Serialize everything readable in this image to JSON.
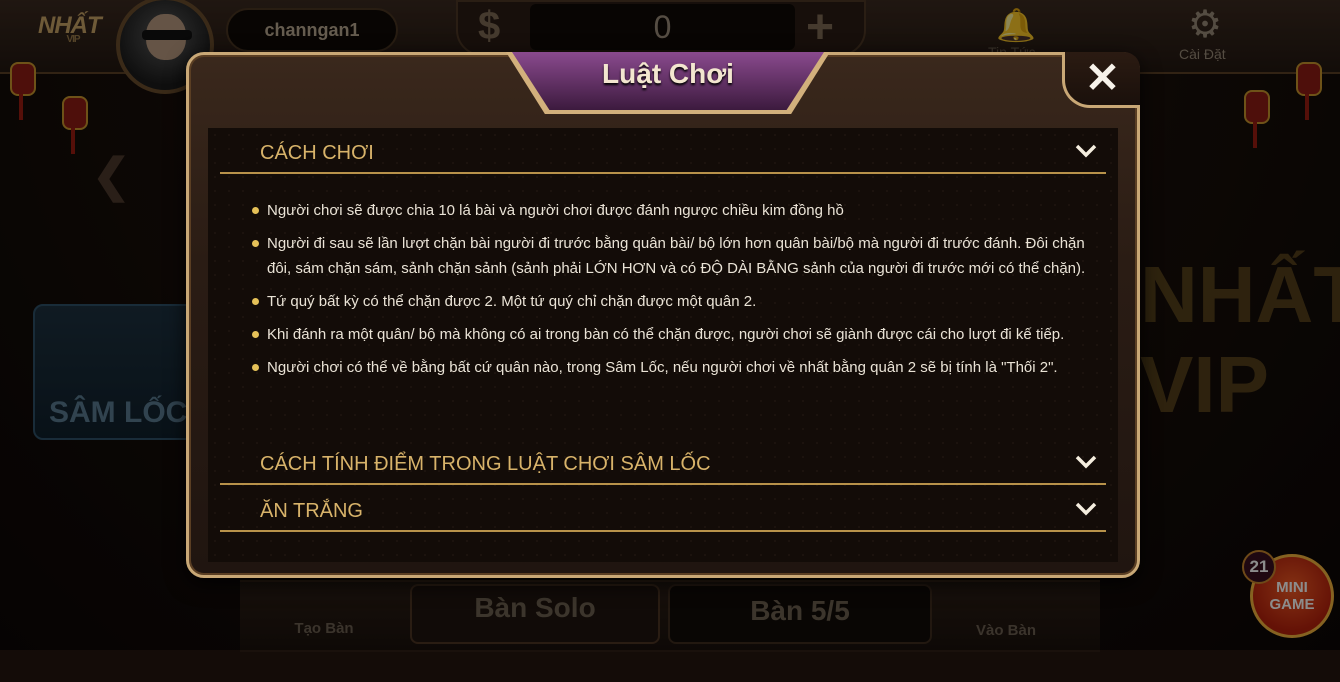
{
  "topbar": {
    "logo": "NHẤT",
    "logo_sub": "VIP",
    "username": "channgan1",
    "balance": "0",
    "notifications_label": "Tin Tức",
    "settings_label": "Cài Đặt"
  },
  "lobby": {
    "game_card_label": "SÂM LỐC",
    "vip_art_text": "NHẤT VIP",
    "tab_create": "Tạo Bàn",
    "tab_solo": "Bàn Solo",
    "tab_55": "Bàn 5/5",
    "tab_enter": "Vào Bàn",
    "mini_game": "MINI GAME",
    "mini_game_badge": "21"
  },
  "dialog": {
    "title": "Luật Chơi",
    "sections": [
      {
        "title": "CÁCH CHƠI",
        "expanded": true
      },
      {
        "title": "CÁCH TÍNH ĐIỂM TRONG LUẬT CHƠI SÂM LỐC",
        "expanded": false
      },
      {
        "title": "ĂN TRẮNG",
        "expanded": false
      }
    ],
    "rules": [
      "Người chơi sẽ được chia 10 lá bài và người chơi được đánh ngược chiều kim đồng hồ",
      "Người đi sau sẽ lần lượt chặn bài người đi trước bằng quân bài/ bộ lớn hơn quân bài/bộ mà người đi trước đánh. Đôi chặn đôi, sám chặn sám, sảnh chặn sảnh (sảnh phải LỚN HƠN và có ĐỘ DÀI BẰNG sảnh của người đi trước mới có thể chặn).",
      "Tứ quý bất kỳ có thể chặn được 2. Một tứ quý chỉ chặn được một quân 2.",
      "Khi đánh ra một quân/ bộ mà không có ai trong bàn có thể chặn được, người chơi sẽ giành được cái cho lượt đi kế tiếp.",
      "Người chơi có thể về bằng bất cứ quân nào, trong Sâm Lốc, nếu người chơi về nhất bằng quân 2 sẽ bị tính là \"Thối 2\"."
    ]
  },
  "colors": {
    "gold": "#d8b36a",
    "text": "#eae3d6",
    "bullet": "#e5c158",
    "title_tab": "#6a336e"
  }
}
